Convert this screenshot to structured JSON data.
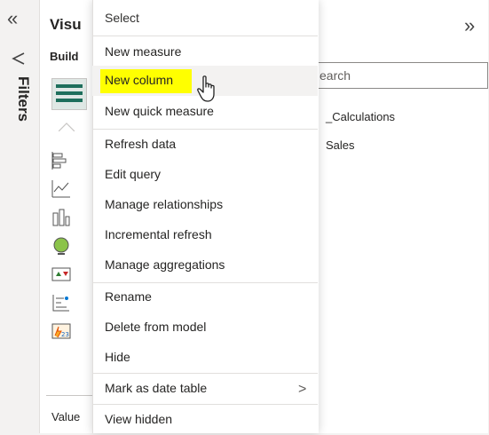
{
  "rail": {
    "label": "Filters",
    "collapse_glyph": "«"
  },
  "viz": {
    "title": "Visu",
    "build_label": "Build",
    "values_tab": "Value",
    "icons": [
      "stacked-bar-chart-icon",
      "line-chart-icon",
      "ribbon-chart-icon",
      "map-icon",
      "kpi-icon",
      "key-influencers-icon",
      "power-apps-icon"
    ]
  },
  "data_pane": {
    "expand_glyph": "»",
    "search_placeholder": "earch",
    "tables": [
      "_Calculations",
      "Sales"
    ]
  },
  "menu": {
    "header": "Select",
    "items": [
      {
        "label": "New measure"
      },
      {
        "label": "New column"
      },
      {
        "label": "New quick measure"
      },
      {
        "label": "Refresh data"
      },
      {
        "label": "Edit query"
      },
      {
        "label": "Manage relationships"
      },
      {
        "label": "Incremental refresh"
      },
      {
        "label": "Manage aggregations"
      },
      {
        "label": "Rename"
      },
      {
        "label": "Delete from model"
      },
      {
        "label": "Hide"
      },
      {
        "label": "Mark as date table"
      },
      {
        "label": "View hidden"
      }
    ],
    "submenu_glyph": ">"
  },
  "colors": {
    "highlight": "#ffff00",
    "accent": "#1e6f5c",
    "hover": "#f3f2f1"
  }
}
